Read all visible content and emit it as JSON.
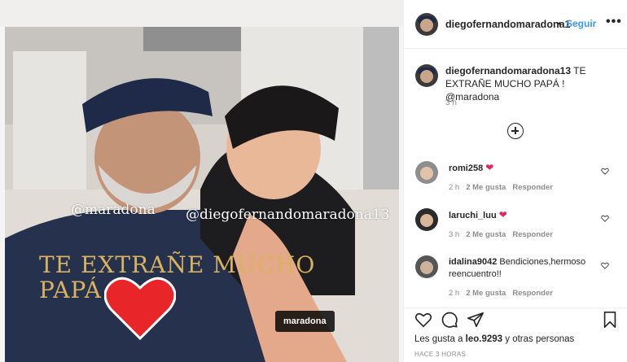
{
  "post": {
    "mentions": [
      "@maradona",
      "@diegofernandomaradona13"
    ],
    "caption_line_1": "TE EXTRAÑE MUCHO",
    "caption_line_2": "PAPÁ",
    "tag_label": "maradona"
  },
  "header": {
    "username": "diegofernandomaradona1",
    "dot": "•",
    "follow_label": "Seguir",
    "more_label": "•••"
  },
  "caption": {
    "username": "diegofernandomaradona13",
    "text": " TE EXTRAÑE MUCHO PAPÁ ! @maradona",
    "time": "3 h"
  },
  "comments": [
    {
      "username": "romi258",
      "text": "",
      "heart": "❤",
      "time": "2 h",
      "likes": "2 Me gusta",
      "reply": "Responder"
    },
    {
      "username": "laruchi_luu",
      "text": "",
      "heart": "❤",
      "time": "3 h",
      "likes": "2 Me gusta",
      "reply": "Responder"
    },
    {
      "username": "idalina9042",
      "text": " Bendiciones,hermoso reencuentro!!",
      "heart": "",
      "time": "2 h",
      "likes": "2 Me gusta",
      "reply": "Responder"
    }
  ],
  "likes": {
    "prefix": "Les gusta a ",
    "user": "leo.9293",
    "suffix": " y otras personas"
  },
  "posted_ago": "HACE 3 HORAS",
  "colors": {
    "follow": "#3897f0",
    "caption_gold": "#d9b25e",
    "heart_red": "#e0245e"
  }
}
